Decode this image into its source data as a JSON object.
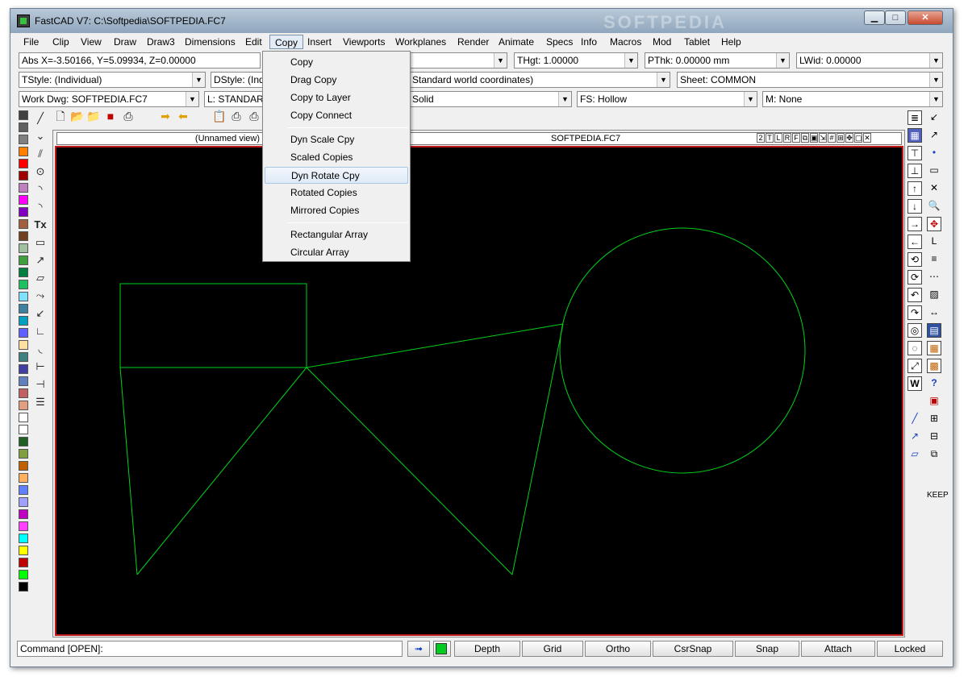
{
  "window": {
    "title": "FastCAD V7: C:\\Softpedia\\SOFTPEDIA.FC7",
    "watermark": "SOFTPEDIA",
    "min_label": "▁",
    "max_label": "□",
    "close_label": "✕"
  },
  "menu": [
    "File",
    "Clip",
    "View",
    "Draw",
    "Draw3",
    "Dimensions",
    "Edit",
    "Copy",
    "Insert",
    "Viewports",
    "Workplanes",
    "Render",
    "Animate",
    "Specs",
    "Info",
    "Macros",
    "Mod",
    "Tablet",
    "Help"
  ],
  "row1": {
    "coords": "Abs X=-3.50166, Y=5.09934, Z=0.00000",
    "thgt": "THgt: 1.00000",
    "pthk": "PThk: 0.00000 mm",
    "lwid": "LWid: 0.00000"
  },
  "row2": {
    "tstyle": "TStyle: (Individual)",
    "dstyle": "DStyle: (Indiv",
    "coords_sys": "Standard world coordinates)",
    "sheet": "Sheet: COMMON"
  },
  "row3": {
    "workdwg": "Work Dwg: SOFTPEDIA.FC7",
    "layer": "L: STANDARD",
    "linestyle": "Solid",
    "fillstyle": "FS: Hollow",
    "material": "M: None"
  },
  "copy_menu": {
    "items": [
      "Copy",
      "Drag Copy",
      "Copy to Layer",
      "Copy Connect",
      "Dyn Scale Cpy",
      "Scaled Copies",
      "Dyn Rotate Cpy",
      "Rotated Copies",
      "Mirrored Copies",
      "Rectangular Array",
      "Circular Array"
    ],
    "highlighted": "Dyn Rotate Cpy"
  },
  "viewport": {
    "left_title": "(Unnamed view)",
    "right_title": "SOFTPEDIA.FC7",
    "controls": [
      "2",
      "T",
      "L",
      "R",
      "F",
      "⧉",
      "▣",
      "⇲",
      "#",
      "⊞",
      "✥",
      "▢",
      "✕"
    ]
  },
  "status": {
    "command": "Command [OPEN]:",
    "buttons": [
      "Depth",
      "Grid",
      "Ortho",
      "CsrSnap",
      "Snap",
      "Attach",
      "Locked"
    ]
  },
  "palette_colors": [
    "#404040",
    "#606060",
    "#808080",
    "#ff8000",
    "#ff0000",
    "#a00000",
    "#c080c0",
    "#ff00ff",
    "#8000c0",
    "#a06040",
    "#704020",
    "#a0c0a0",
    "#40a040",
    "#008040",
    "#20c060",
    "#80e0ff",
    "#4080a0",
    "#00a0c0",
    "#6060ff",
    "#ffe0a0",
    "#408080",
    "#4040a0",
    "#6080c0",
    "#c06060",
    "#e0a080",
    "#ffffff",
    "#ffffff",
    "#206020",
    "#80a040",
    "#c06000",
    "#ffb060",
    "#6080ff",
    "#a0a0ff",
    "#c000c0",
    "#ff40ff",
    "#00ffff",
    "#ffff00",
    "#c00000",
    "#00ff00",
    "#000000"
  ],
  "colors": {
    "drawing_stroke": "#00d21a",
    "canvas_bg": "#000000",
    "canvas_border": "#c01818"
  }
}
